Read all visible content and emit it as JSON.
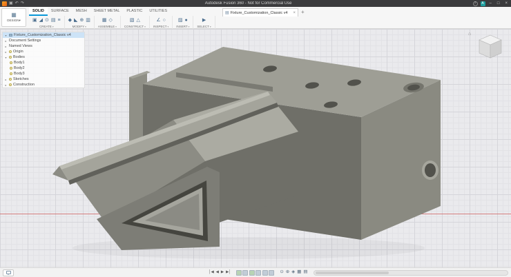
{
  "title_bar": {
    "title": "Autodesk Fusion 360 - Not for Commercial Use",
    "help": "?",
    "avatar_initial": "A",
    "minimize": "–",
    "maximize": "□",
    "close": "×"
  },
  "workspace": {
    "label": "DESIGN",
    "caret": "▾"
  },
  "ribbon": {
    "tabs": [
      "SOLID",
      "SURFACE",
      "MESH",
      "SHEET METAL",
      "PLASTIC",
      "UTILITIES"
    ],
    "active_tab": "SOLID",
    "caret": "▾",
    "groups": [
      {
        "label": "CREATE"
      },
      {
        "label": "MODIFY"
      },
      {
        "label": "ASSEMBLE"
      },
      {
        "label": "CONSTRUCT"
      },
      {
        "label": "INSPECT"
      },
      {
        "label": "INSERT"
      },
      {
        "label": "SELECT"
      }
    ]
  },
  "document_tabs": {
    "active_title": "Fixture_Customization_Classic v4",
    "close": "×",
    "add": "+"
  },
  "browser": {
    "root_label": "Fixture_Customization_Classic v4",
    "items": [
      {
        "label": "Document Settings",
        "expander": "▸"
      },
      {
        "label": "Named Views",
        "expander": "▸"
      },
      {
        "label": "Origin",
        "expander": "▸"
      },
      {
        "label": "Bodies",
        "expander": "▾"
      },
      {
        "label": "Body1",
        "expander": ""
      },
      {
        "label": "Body2",
        "expander": ""
      },
      {
        "label": "Body3",
        "expander": ""
      },
      {
        "label": "Sketches",
        "expander": "▸"
      },
      {
        "label": "Construction",
        "expander": "▸"
      }
    ]
  },
  "viewcube": {
    "home": "⌂"
  },
  "timeline": {
    "to_start": "│◀",
    "step_back": "◀",
    "play": "▶",
    "to_end": "▶│"
  },
  "icons": {
    "save": "▣",
    "undo": "↶",
    "redo": "↷",
    "workspace_grid": "▦",
    "doc": "▤",
    "create_1": "▣",
    "create_2": "◢",
    "create_3": "⊙",
    "create_4": "▤",
    "create_5": "≡",
    "modify_1": "◆",
    "modify_2": "◣",
    "modify_3": "⊕",
    "modify_4": "▥",
    "assemble_1": "▦",
    "assemble_2": "◇",
    "construct_1": "▧",
    "construct_2": "△",
    "inspect_1": "∠",
    "inspect_2": "○",
    "insert_1": "▨",
    "insert_2": "●",
    "select_1": "▶",
    "nav_orbit": "⊙",
    "nav_pan": "⊕",
    "nav_zoom": "◈",
    "nav_grid": "▦",
    "nav_display": "▤"
  },
  "canvas": {
    "background": "#eaeaed",
    "grid_minor": "#e2e2e6",
    "grid_major": "#d5d5da",
    "x_axis_color": "#cf5a5a"
  },
  "model": {
    "name": "fixture-block-assembly",
    "colors": {
      "top": "#9e9e95",
      "top_bright": "#ababa2",
      "right": "#8a8a81",
      "front": "#6f6f68",
      "plate": "#8f8f86",
      "plate_top": "#a2a299",
      "slant": "#8c8c84",
      "chute_front": "#7d7d76",
      "opening": "#45453f",
      "funnel": "#a5a59d",
      "funnel_inner": "#8b8b84",
      "ramp": "#a4a49b",
      "ramp_top": "#bcbcb3",
      "ramp_under": "#61615b",
      "bar": "#7a7a73",
      "hole": "#52524c",
      "hole_rim": "#75756d",
      "side_ring": "#a6a69d",
      "shadow": "rgba(60,60,60,0.06)"
    }
  }
}
